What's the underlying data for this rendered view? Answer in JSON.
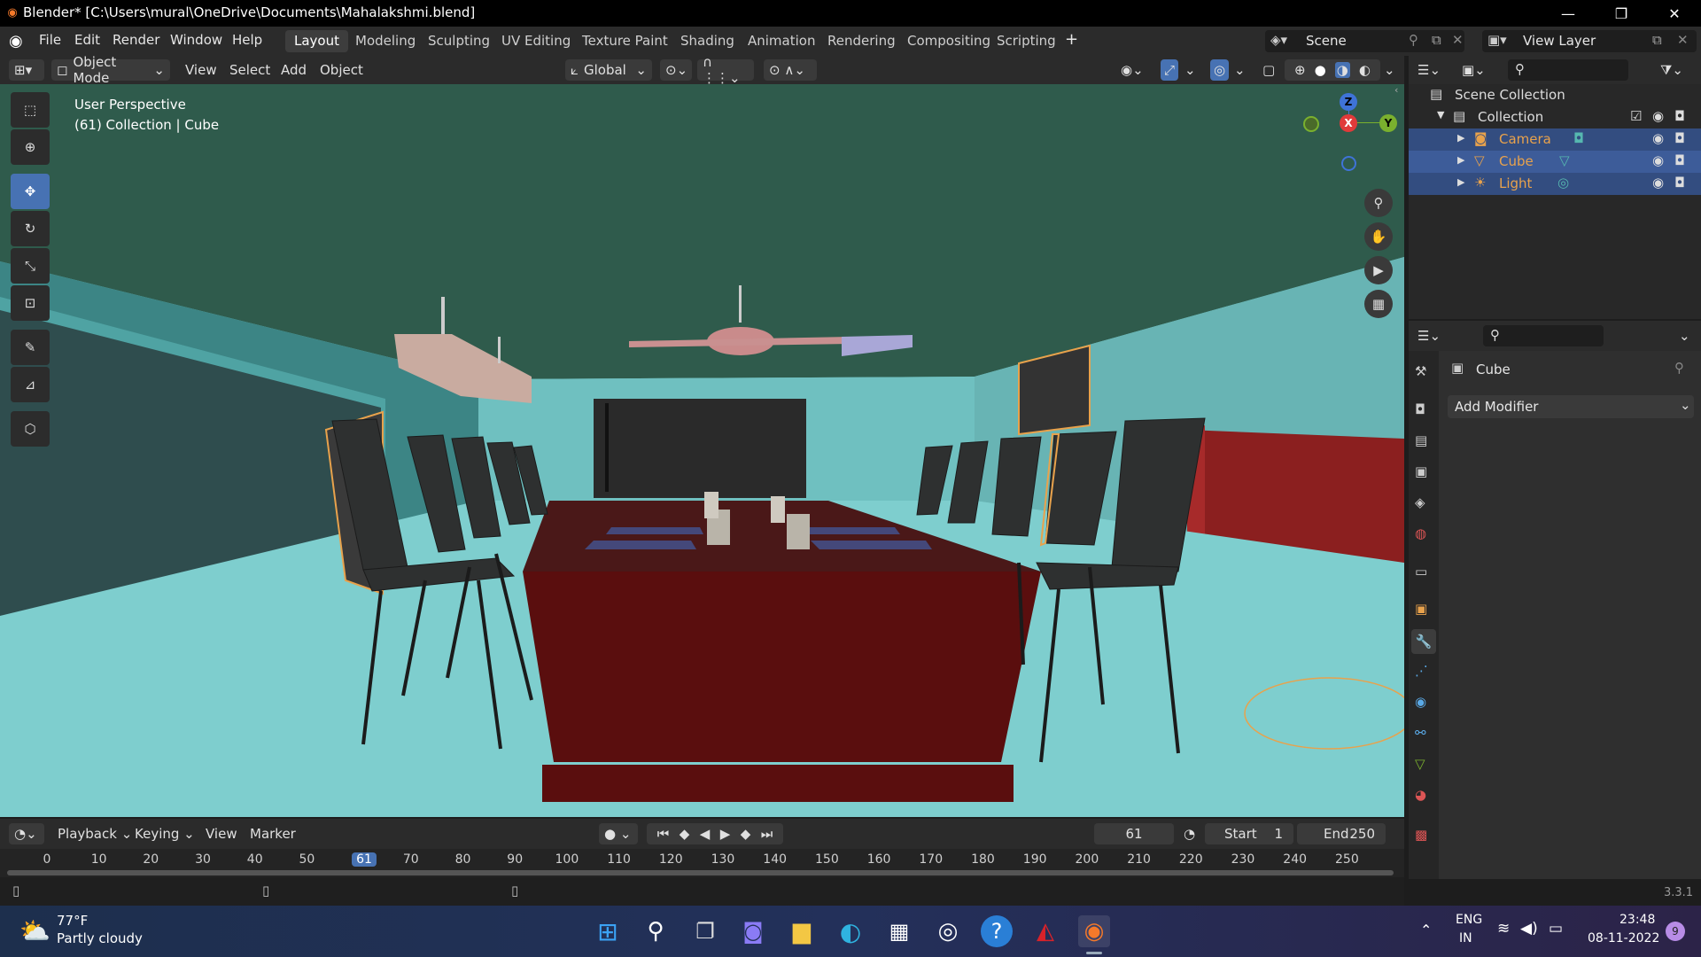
{
  "window": {
    "title": "Blender* [C:\\Users\\mural\\OneDrive\\Documents\\Mahalakshmi.blend]"
  },
  "menu": [
    "File",
    "Edit",
    "Render",
    "Window",
    "Help"
  ],
  "workspaces": [
    "Layout",
    "Modeling",
    "Sculpting",
    "UV Editing",
    "Texture Paint",
    "Shading",
    "Animation",
    "Rendering",
    "Compositing",
    "Scripting"
  ],
  "active_workspace": "Layout",
  "scene": {
    "name": "Scene",
    "view_layer": "View Layer"
  },
  "viewport_header": {
    "mode": "Object Mode",
    "menus": [
      "View",
      "Select",
      "Add",
      "Object"
    ],
    "transform_orientation": "Global"
  },
  "viewport": {
    "info_line1": "User Perspective",
    "info_line2": "(61) Collection | Cube"
  },
  "gizmo": {
    "z": "Z",
    "x": "X",
    "y": "Y"
  },
  "outliner": {
    "root": "Scene Collection",
    "collection": "Collection",
    "items": [
      {
        "name": "Camera",
        "color": "#e8a24c"
      },
      {
        "name": "Cube",
        "color": "#e8a24c"
      },
      {
        "name": "Light",
        "color": "#e8a24c"
      }
    ]
  },
  "properties": {
    "object_name": "Cube",
    "add_modifier": "Add Modifier"
  },
  "timeline": {
    "menus": [
      "Playback",
      "Keying",
      "View",
      "Marker"
    ],
    "current_frame": "61",
    "start_label": "Start",
    "start": "1",
    "end_label": "End",
    "end": "250",
    "ticks": [
      "0",
      "10",
      "20",
      "30",
      "40",
      "50",
      "61",
      "70",
      "80",
      "90",
      "100",
      "110",
      "120",
      "130",
      "140",
      "150",
      "160",
      "170",
      "180",
      "190",
      "200",
      "210",
      "220",
      "230",
      "240",
      "250"
    ]
  },
  "version": "3.3.1",
  "taskbar": {
    "weather_temp": "77°F",
    "weather_desc": "Partly cloudy",
    "lang1": "ENG",
    "lang2": "IN",
    "time": "23:48",
    "date": "08-11-2022",
    "notif_count": "9"
  },
  "colors": {
    "accent": "#4772b3",
    "selected": "#e8a24c",
    "wall": "#76c9c9",
    "ceiling": "#2f5b4c"
  }
}
